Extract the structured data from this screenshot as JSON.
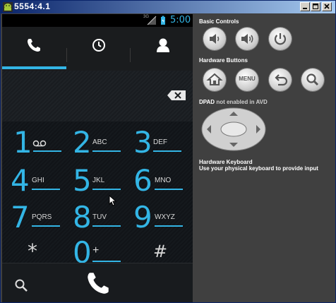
{
  "window": {
    "title": "5554:4.1"
  },
  "phone": {
    "status": {
      "network": "3G",
      "time": "5:00"
    },
    "tabs": [
      "phone-tab",
      "recent-tab",
      "contacts-tab"
    ],
    "keys": [
      {
        "num": "1",
        "letters": ""
      },
      {
        "num": "2",
        "letters": "ABC"
      },
      {
        "num": "3",
        "letters": "DEF"
      },
      {
        "num": "4",
        "letters": "GHI"
      },
      {
        "num": "5",
        "letters": "JKL"
      },
      {
        "num": "6",
        "letters": "MNO"
      },
      {
        "num": "7",
        "letters": "PQRS"
      },
      {
        "num": "8",
        "letters": "TUV"
      },
      {
        "num": "9",
        "letters": "WXYZ"
      },
      {
        "num": "*",
        "letters": ""
      },
      {
        "num": "0",
        "letters": "+"
      },
      {
        "num": "#",
        "letters": ""
      }
    ],
    "colors": {
      "accent": "#33b5e5"
    }
  },
  "emulator": {
    "basic_controls_title": "Basic Controls",
    "hardware_buttons_title": "Hardware Buttons",
    "menu_label": "MENU",
    "dpad_title": "DPAD",
    "dpad_note": "not enabled in AVD",
    "keyboard_title": "Hardware Keyboard",
    "keyboard_note": "Use your physical keyboard to provide input"
  }
}
